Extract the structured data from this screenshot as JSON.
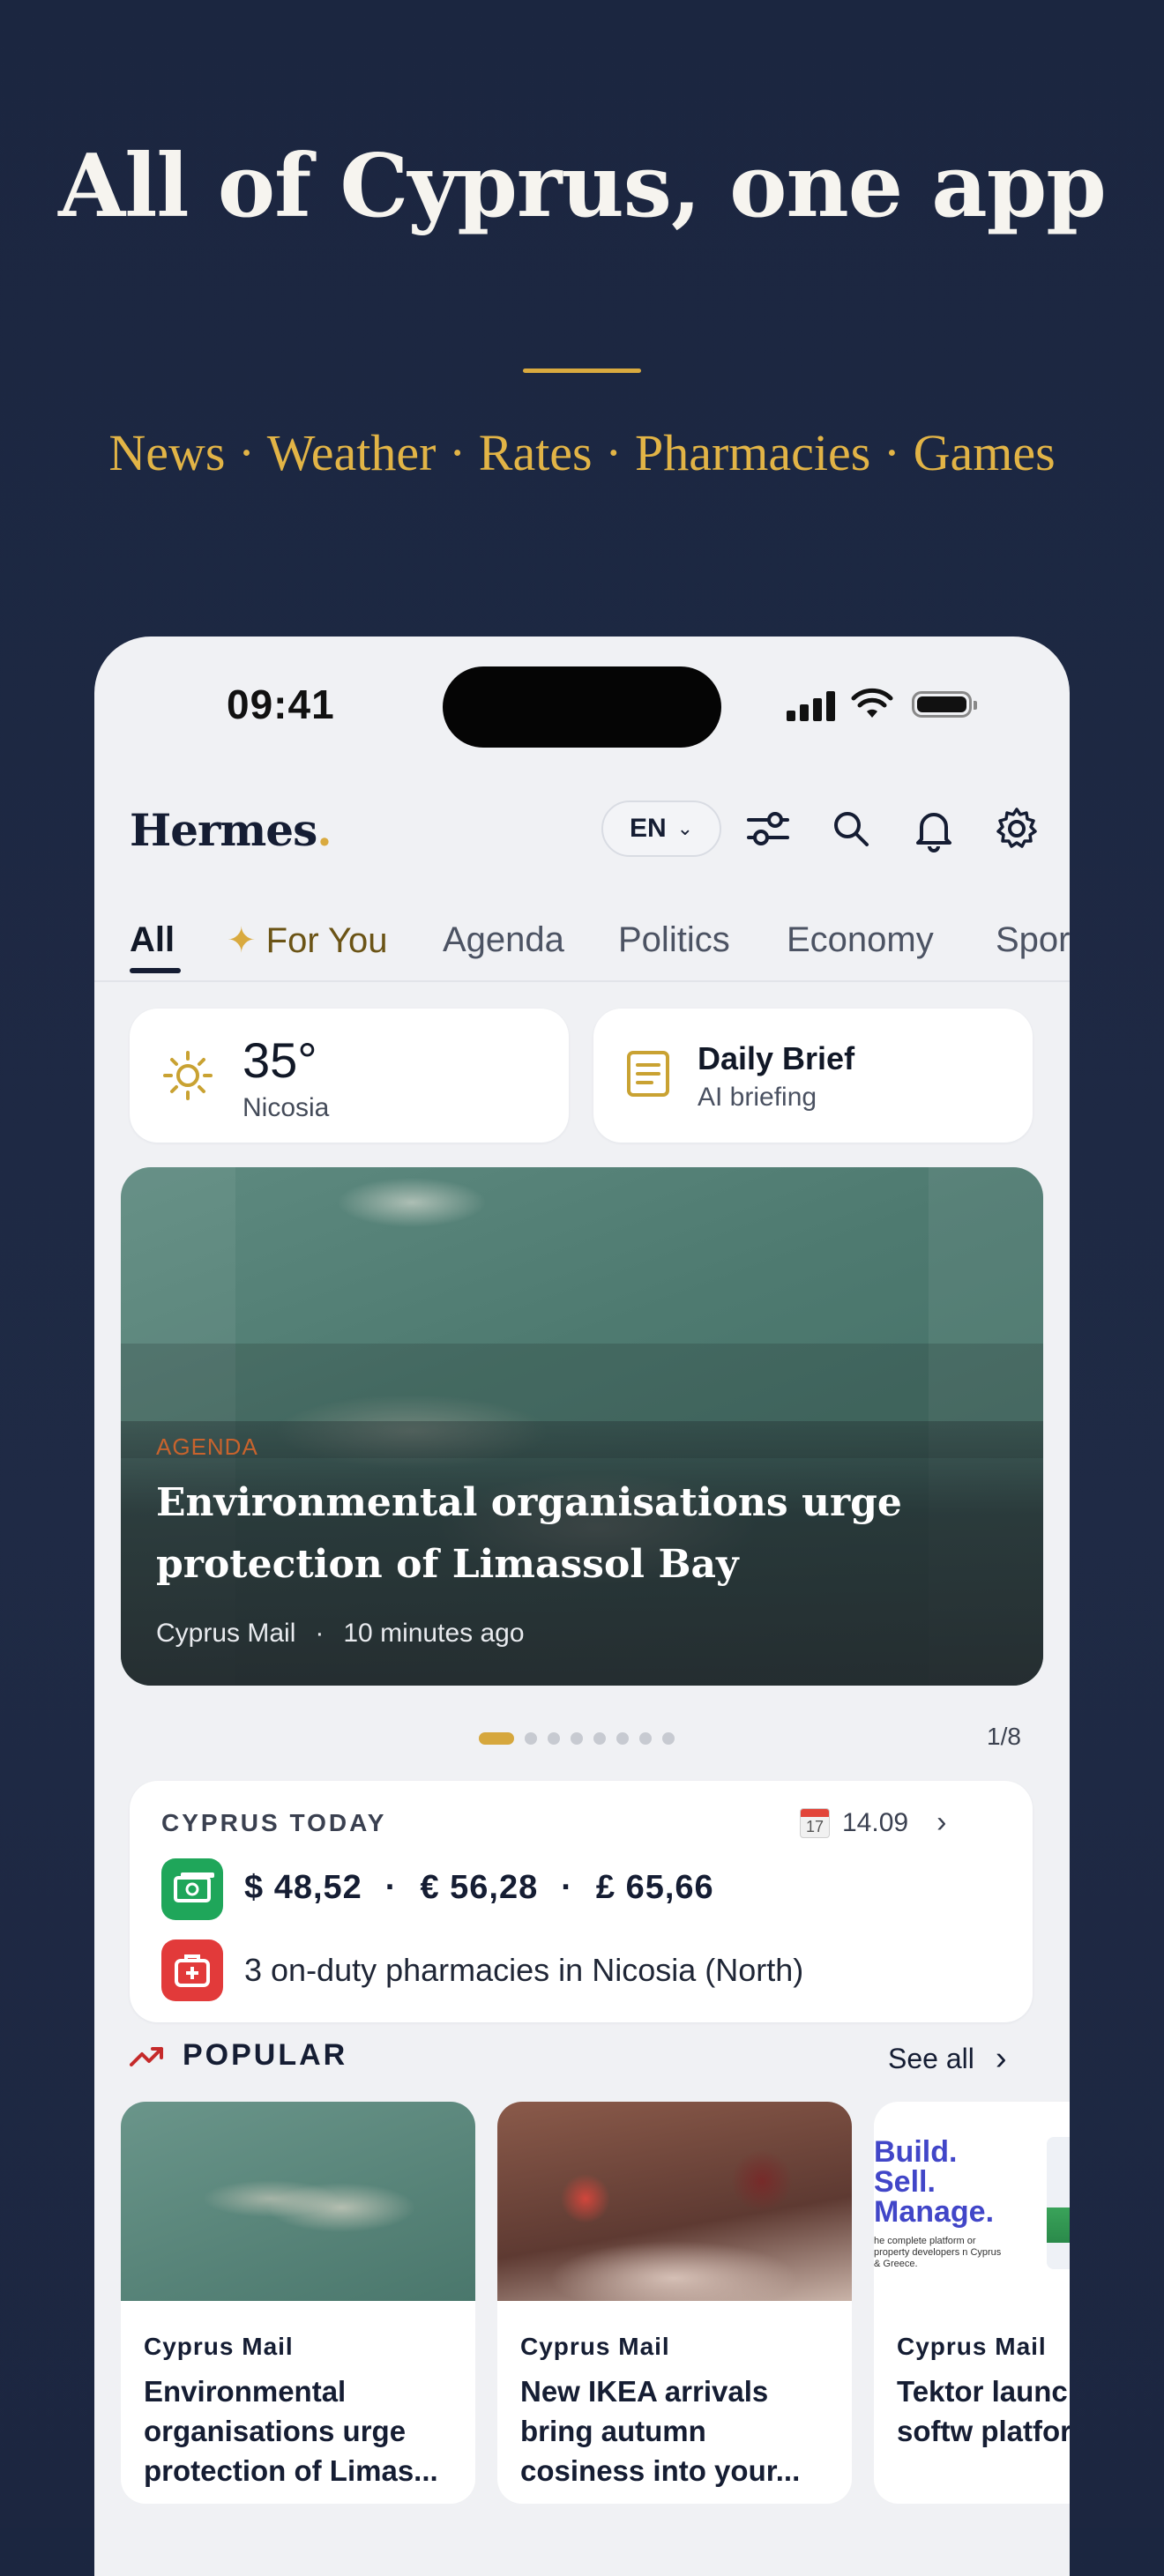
{
  "promo": {
    "headline": "All of Cyprus, one app",
    "tagline": "News · Weather · Rates · Pharmacies · Games"
  },
  "status_bar": {
    "time": "09:41"
  },
  "app_bar": {
    "logo": "Hermes",
    "logo_dot": ".",
    "language": "EN",
    "icons": [
      "filter-icon",
      "search-icon",
      "bell-icon",
      "gear-icon"
    ]
  },
  "tabs": [
    {
      "label": "All",
      "active": true
    },
    {
      "label": "For You",
      "icon": "sparkle-icon"
    },
    {
      "label": "Agenda"
    },
    {
      "label": "Politics"
    },
    {
      "label": "Economy"
    },
    {
      "label": "Spor"
    }
  ],
  "weather": {
    "temp": "35°",
    "city": "Nicosia",
    "icon": "sun-icon"
  },
  "daily_brief": {
    "title": "Daily Brief",
    "subtitle": "AI briefing",
    "icon": "document-icon"
  },
  "hero": {
    "category": "AGENDA",
    "title": "Environmental organisations urge protection of Limassol Bay",
    "source": "Cyprus Mail",
    "separator": "·",
    "time": "10 minutes ago",
    "pager": "1/8",
    "slide_index": 1,
    "slide_count": 8
  },
  "cyprus_today": {
    "label": "CYPRUS TODAY",
    "date": "14.09",
    "calendar_day": "17",
    "rates": [
      "$ 48,52",
      "€ 56,28",
      "£ 65,66"
    ],
    "rate_separator": "·",
    "pharmacies": "3 on-duty pharmacies in Nicosia (North)"
  },
  "popular": {
    "heading": "POPULAR",
    "see_all": "See all",
    "items": [
      {
        "source": "Cyprus Mail",
        "title": "Environmental organisations urge protection of Limas..."
      },
      {
        "source": "Cyprus Mail",
        "title": "New IKEA arrivals bring autumn cosiness into your..."
      },
      {
        "source": "Cyprus Mail",
        "title": "Tektor launc in-one softw platform for",
        "ad_line1": "Build.",
        "ad_line2": "Sell.",
        "ad_line3": "Manage.",
        "ad_small": "he complete platform or property developers n Cyprus & Greece."
      }
    ]
  },
  "colors": {
    "background": "#1e2843",
    "accent_gold": "#d9aa3f",
    "brand_navy": "#151d33",
    "rates_green": "#1fa65a",
    "pharmacy_red": "#e23a3a"
  }
}
